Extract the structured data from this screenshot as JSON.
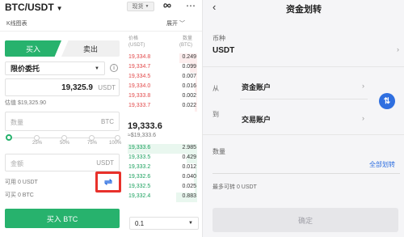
{
  "left": {
    "pair": "BTC/USDT",
    "spot_label": "现货",
    "kline_label": "K线图表",
    "expand_label": "展开",
    "tabs": {
      "buy": "买入",
      "sell": "卖出"
    },
    "order_type": "限价委托",
    "price_value": "19,325.9",
    "price_unit": "USDT",
    "estimate": "估值 $19,325.90",
    "amount_placeholder": "数量",
    "amount_unit": "BTC",
    "slider_percents": [
      "25%",
      "50%",
      "75%",
      "100%"
    ],
    "total_placeholder": "金额",
    "total_unit": "USDT",
    "available": "可用 0 USDT",
    "buyable": "可买 0 BTC",
    "buy_button": "买入 BTC",
    "orderbook": {
      "price_header": "价格\n(USDT)",
      "qty_header": "数量\n(BTC)",
      "asks": [
        {
          "price": "19,334.8",
          "qty": "0.249",
          "fill": 0.25
        },
        {
          "price": "19,334.7",
          "qty": "0.099",
          "fill": 0.1
        },
        {
          "price": "19,334.5",
          "qty": "0.007",
          "fill": 0.02
        },
        {
          "price": "19,334.0",
          "qty": "0.016",
          "fill": 0.03
        },
        {
          "price": "19,333.8",
          "qty": "0.002",
          "fill": 0.01
        },
        {
          "price": "19,333.7",
          "qty": "0.022",
          "fill": 0.04
        }
      ],
      "last_price": "19,333.6",
      "last_fiat": "≈$19,333.6",
      "bids": [
        {
          "price": "19,333.6",
          "qty": "2.985",
          "fill": 1.0
        },
        {
          "price": "19,333.5",
          "qty": "0.429",
          "fill": 0.15
        },
        {
          "price": "19,333.2",
          "qty": "0.012",
          "fill": 0.02
        },
        {
          "price": "19,332.6",
          "qty": "0.040",
          "fill": 0.05
        },
        {
          "price": "19,332.5",
          "qty": "0.025",
          "fill": 0.03
        },
        {
          "price": "19,332.4",
          "qty": "0.883",
          "fill": 0.3
        }
      ],
      "depth": "0.1"
    },
    "colors": {
      "buy": "#27b26d",
      "ask": "#e2494a",
      "bid": "#1ba15e",
      "highlight": "#e8312b",
      "transfer": "#2f6fe0"
    }
  },
  "right": {
    "title": "资金划转",
    "coin_label": "币种",
    "coin_value": "USDT",
    "from_label": "从",
    "from_value": "资金账户",
    "to_label": "到",
    "to_value": "交易账户",
    "qty_label": "数量",
    "transfer_all": "全部划转",
    "max_transfer": "最多可转 0 USDT",
    "confirm": "确定"
  }
}
